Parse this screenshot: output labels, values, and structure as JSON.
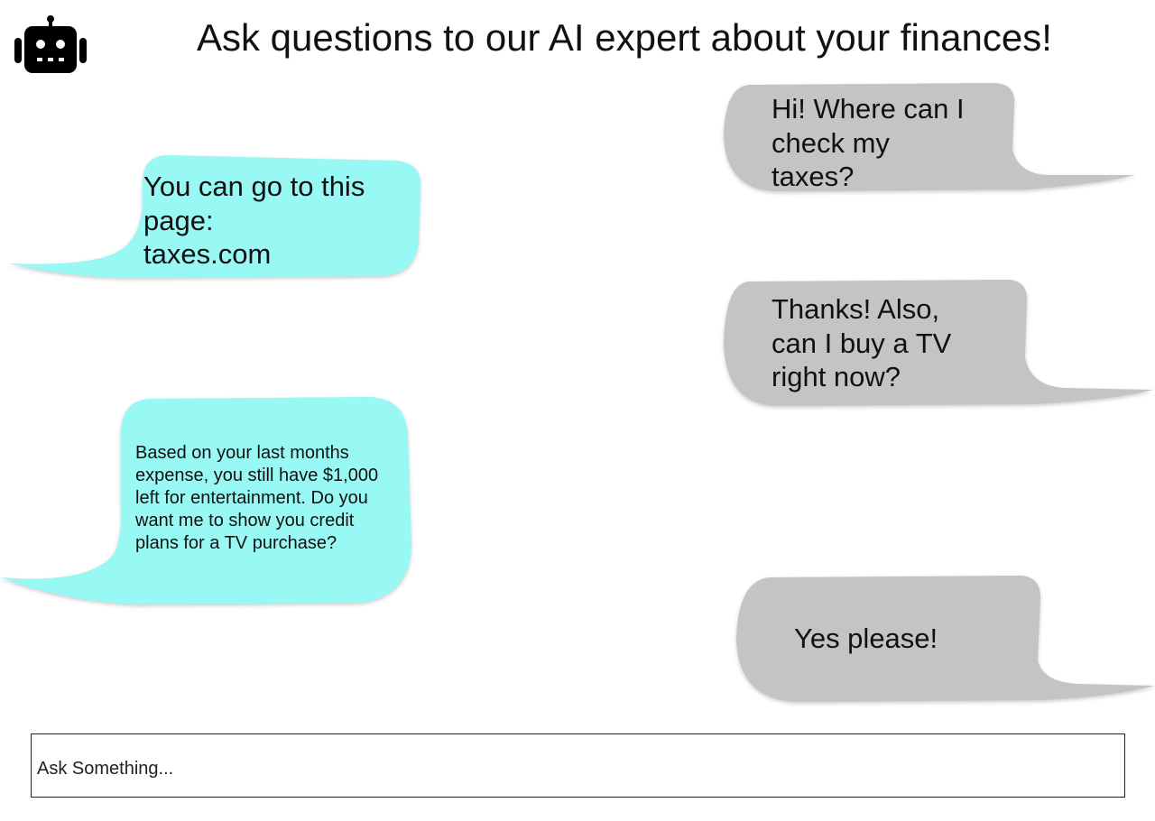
{
  "header": {
    "title": "Ask questions to our AI expert about your finances!",
    "avatar_icon": "robot-icon"
  },
  "colors": {
    "bot_bubble": "#98F8F3",
    "user_bubble": "#C4C4C4"
  },
  "messages": [
    {
      "sender": "user",
      "text": "Hi! Where can I\ncheck my\ntaxes?"
    },
    {
      "sender": "bot",
      "text": "You can go to this\npage:\ntaxes.com"
    },
    {
      "sender": "user",
      "text": "Thanks! Also,\ncan I buy a TV\nright now?"
    },
    {
      "sender": "bot",
      "text": "Based on your last months\nexpense, you still have $1,000\nleft for entertainment. Do you\nwant me to show you credit\nplans for a TV purchase?"
    },
    {
      "sender": "user",
      "text": "Yes please!"
    }
  ],
  "composer": {
    "placeholder": "Ask Something...",
    "value": ""
  }
}
